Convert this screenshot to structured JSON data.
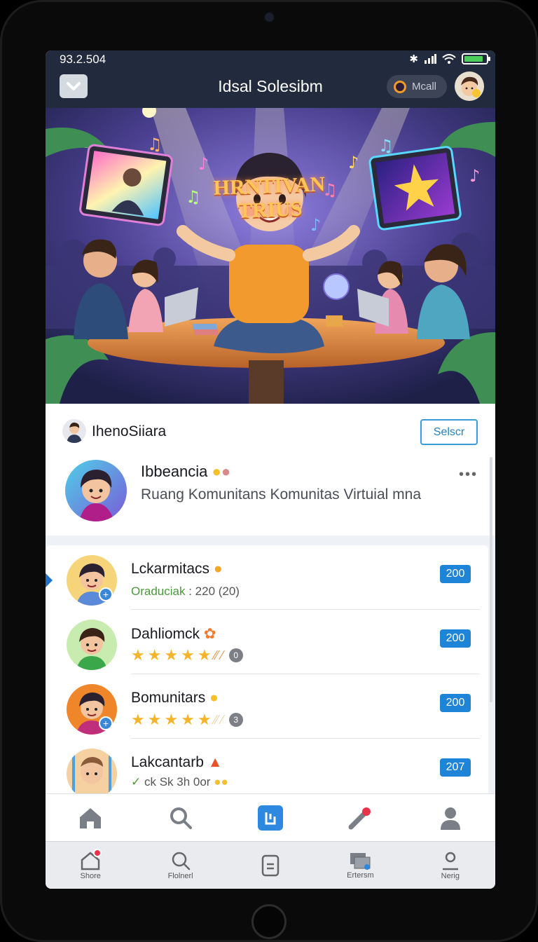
{
  "status": {
    "time": "93.2.504"
  },
  "header": {
    "title": "Idsal Solesibm",
    "mode_label": "Mcall"
  },
  "hero": {
    "title": "HRNTIVAN TRIUS"
  },
  "community": {
    "room_name": "IhenoSiiara",
    "select_label": "Selscr",
    "host_name": "Ibbeancia",
    "host_desc": "Ruang Komunitans Komunitas Virtuial mna",
    "more": "•••"
  },
  "members": [
    {
      "name": "Lckarmitacs",
      "role": "Oraduciak",
      "sub": " : 220 (20)",
      "score": "200"
    },
    {
      "name": "Dahliomck",
      "badge": "0",
      "score": "200"
    },
    {
      "name": "Bomunitars",
      "badge": "3",
      "score": "200"
    },
    {
      "name": "Lakcantarb",
      "sub": "ck Sk 3h 0or",
      "score": "207"
    }
  ],
  "nav_bottom": [
    {
      "label": "Shore"
    },
    {
      "label": "Flolnerl"
    },
    {
      "label": ""
    },
    {
      "label": "Ertersm"
    },
    {
      "label": "Nerig"
    }
  ],
  "colors": {
    "accent": "#1e84d8",
    "header": "#222a3d",
    "star": "#f5b52a"
  }
}
